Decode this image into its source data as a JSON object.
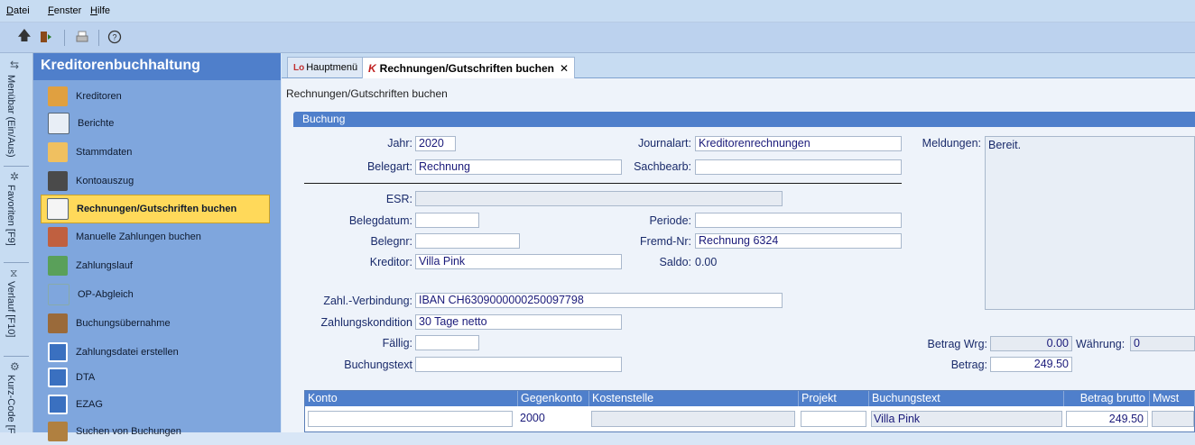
{
  "menu": {
    "items": [
      "Datei",
      "Fenster",
      "Hilfe"
    ]
  },
  "toolbar": {
    "icons": [
      "up-arrow-icon",
      "exit-door-icon",
      "print-icon",
      "help-icon"
    ]
  },
  "side_tabs": [
    "Menübar (Ein/Aus)",
    "Favoriten [F9]",
    "Verlauf [F10]",
    "Kurz-Code [F"
  ],
  "nav": {
    "title": "Kreditorenbuchhaltung",
    "items": [
      {
        "label": "Kreditoren"
      },
      {
        "label": "Berichte"
      },
      {
        "label": "Stammdaten"
      },
      {
        "label": "Kontoauszug"
      },
      {
        "label": "Rechnungen/Gutschriften buchen"
      },
      {
        "label": "Manuelle Zahlungen buchen"
      },
      {
        "label": "Zahlungslauf"
      },
      {
        "label": "OP-Abgleich"
      },
      {
        "label": "Buchungsübernahme"
      },
      {
        "label": "Zahlungsdatei erstellen"
      },
      {
        "label": "DTA"
      },
      {
        "label": "EZAG"
      },
      {
        "label": "Suchen von Buchungen"
      }
    ]
  },
  "tabs": {
    "home": "Hauptmenü",
    "active": "Rechnungen/Gutschriften buchen",
    "close": "✕"
  },
  "page": {
    "subtitle": "Rechnungen/Gutschriften buchen",
    "section": "Buchung"
  },
  "form": {
    "jahr_label": "Jahr:",
    "jahr": "2020",
    "belegart_label": "Belegart:",
    "belegart": "Rechnung",
    "journalart_label": "Journalart:",
    "journalart": "Kreditorenrechnungen",
    "sachbearb_label": "Sachbearb:",
    "sachbearb": "",
    "meldungen_label": "Meldungen:",
    "meldungen": "Bereit.",
    "esr_label": "ESR:",
    "esr": "",
    "belegdatum_label": "Belegdatum:",
    "belegdatum": "",
    "periode_label": "Periode:",
    "periode": "",
    "belegnr_label": "Belegnr:",
    "belegnr": "",
    "fremdnr_label": "Fremd-Nr:",
    "fremdnr": "Rechnung 6324",
    "kreditor_label": "Kreditor:",
    "kreditor": "Villa Pink",
    "saldo_label": "Saldo:",
    "saldo": "0.00",
    "zahlverb_label": "Zahl.-Verbindung:",
    "zahlverb": "IBAN  CH6309000000250097798",
    "zahlkond_label": "Zahlungskondition",
    "zahlkond": "30 Tage netto",
    "faellig_label": "Fällig:",
    "faellig": "",
    "buchungstext_label": "Buchungstext",
    "buchungstext": "",
    "betragwrg_label": "Betrag Wrg:",
    "betragwrg": "0.00",
    "waehrung_label": "Währung:",
    "waehrung": "0",
    "betrag_label": "Betrag:",
    "betrag": "249.50"
  },
  "grid": {
    "headers": [
      "Konto",
      "Gegenkonto",
      "Kostenstelle",
      "Projekt",
      "Buchungstext",
      "Betrag brutto",
      "Mwst"
    ],
    "row": {
      "konto": "",
      "gegenkonto": "2000",
      "kostenstelle": "",
      "projekt": "",
      "buchungstext": "Villa Pink",
      "betrag": "249.50",
      "mwst": ""
    }
  }
}
